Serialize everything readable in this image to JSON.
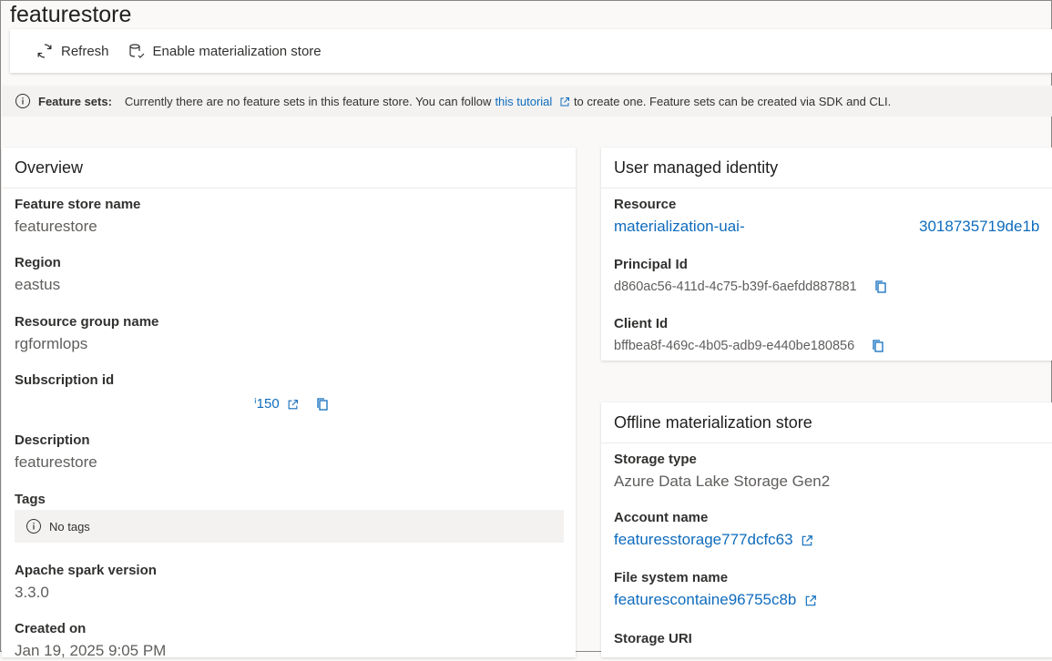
{
  "page": {
    "title": "featurestore"
  },
  "toolbar": {
    "refresh_label": "Refresh",
    "enable_label": "Enable materialization store"
  },
  "infobar": {
    "label": "Feature sets:",
    "text_before": "Currently there are no feature sets in this feature store. You can follow",
    "link": "this tutorial",
    "text_after": "to create one. Feature sets can be created via SDK and CLI."
  },
  "overview": {
    "title": "Overview",
    "feature_store_name_label": "Feature store name",
    "feature_store_name": "featurestore",
    "region_label": "Region",
    "region": "eastus",
    "resource_group_label": "Resource group name",
    "resource_group": "rgformlops",
    "subscription_label": "Subscription id",
    "subscription_partial": "ⁱ150",
    "description_label": "Description",
    "description": "featurestore",
    "tags_label": "Tags",
    "tags_empty": "No tags",
    "spark_label": "Apache spark version",
    "spark_version": "3.3.0",
    "created_label": "Created on",
    "created_on": "Jan 19, 2025 9:05 PM"
  },
  "identity": {
    "title": "User managed identity",
    "resource_label": "Resource",
    "resource_prefix": "materialization-uai-",
    "resource_suffix": "3018735719de1b",
    "principal_label": "Principal Id",
    "principal_id": "d860ac56-411d-4c75-b39f-6aefdd887881",
    "client_label": "Client Id",
    "client_id": "bffbea8f-469c-4b05-adb9-e440be180856"
  },
  "offline_store": {
    "title": "Offline materialization store",
    "storage_type_label": "Storage type",
    "storage_type": "Azure Data Lake Storage Gen2",
    "account_label": "Account name",
    "account_name": "featuresstorage777dcfc63",
    "filesystem_label": "File system name",
    "filesystem_name": "featurescontaine96755c8b",
    "uri_label": "Storage URI"
  },
  "colors": {
    "link": "#0f6cbd",
    "info_bg": "#f3f2f1",
    "page_bg": "#faf9f8"
  }
}
